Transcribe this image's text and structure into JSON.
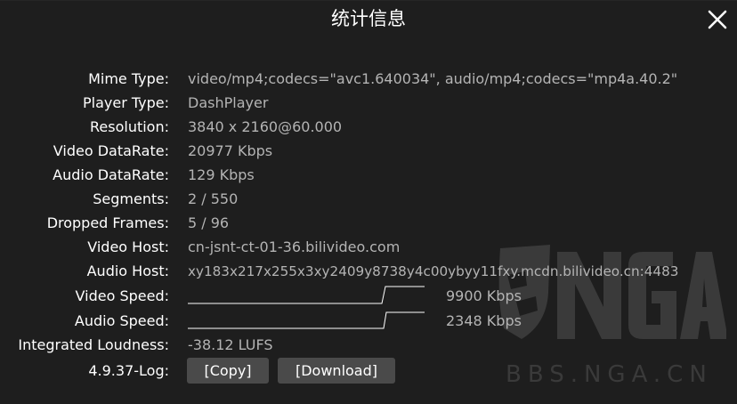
{
  "header": {
    "title": "统计信息"
  },
  "stats": {
    "mime_type": {
      "label": "Mime Type:",
      "value": "video/mp4;codecs=\"avc1.640034\", audio/mp4;codecs=\"mp4a.40.2\""
    },
    "player_type": {
      "label": "Player Type:",
      "value": "DashPlayer"
    },
    "resolution": {
      "label": "Resolution:",
      "value": "3840 x 2160@60.000"
    },
    "video_datarate": {
      "label": "Video DataRate:",
      "value": "20977 Kbps"
    },
    "audio_datarate": {
      "label": "Audio DataRate:",
      "value": "129 Kbps"
    },
    "segments": {
      "label": "Segments:",
      "value": "2 / 550"
    },
    "dropped_frames": {
      "label": "Dropped Frames:",
      "value": "5 / 96"
    },
    "video_host": {
      "label": "Video Host:",
      "value": "cn-jsnt-ct-01-36.bilivideo.com"
    },
    "audio_host": {
      "label": "Audio Host:",
      "value": "xy183x217x255x3xy2409y8738y4c00ybyy11fxy.mcdn.bilivideo.cn:4483"
    },
    "video_speed": {
      "label": "Video Speed:",
      "value": "9900 Kbps"
    },
    "audio_speed": {
      "label": "Audio Speed:",
      "value": "2348 Kbps"
    },
    "loudness": {
      "label": "Integrated Loudness:",
      "value": "-38.12 LUFS"
    },
    "log": {
      "label": "4.9.37-Log:"
    }
  },
  "actions": {
    "copy_label": "[Copy]",
    "download_label": "[Download]"
  },
  "watermark": {
    "logo_text": "NGA",
    "site_text": "BBS.NGA.CN"
  },
  "icons": {
    "close": "close-icon"
  },
  "colors": {
    "background": "#1e1e1e",
    "label": "#ffffff",
    "value": "#b4b4b4",
    "button": "#4a4a4a",
    "watermark": "#3a3a3a"
  }
}
